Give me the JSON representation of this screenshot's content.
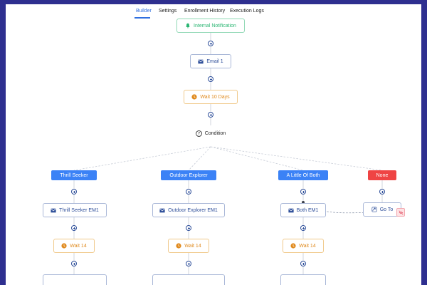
{
  "tabs": [
    "Builder",
    "Settings",
    "Enrollment History",
    "Execution Logs"
  ],
  "nodes": {
    "internal_notification": "Internal Notification",
    "email1": "Email 1",
    "wait10": "Wait 10 Days",
    "condition": "Condition"
  },
  "branches": [
    {
      "label": "Thrill Seeker",
      "email": "Thrill Seeker EM1",
      "wait": "Wait 14"
    },
    {
      "label": "Outdoor Explorer",
      "email": "Outdoor Explorer EM1",
      "wait": "Wait 14"
    },
    {
      "label": "A Little Of Both",
      "email": "Both EM1",
      "wait": "Wait 14"
    },
    {
      "label": "None",
      "goto": "Go To"
    }
  ],
  "colors": {
    "accent": "#3b82f6",
    "none_branch": "#ef4444",
    "wait": "#e08a1e",
    "notification": "#2bb673",
    "background": "#2e2f8f"
  }
}
